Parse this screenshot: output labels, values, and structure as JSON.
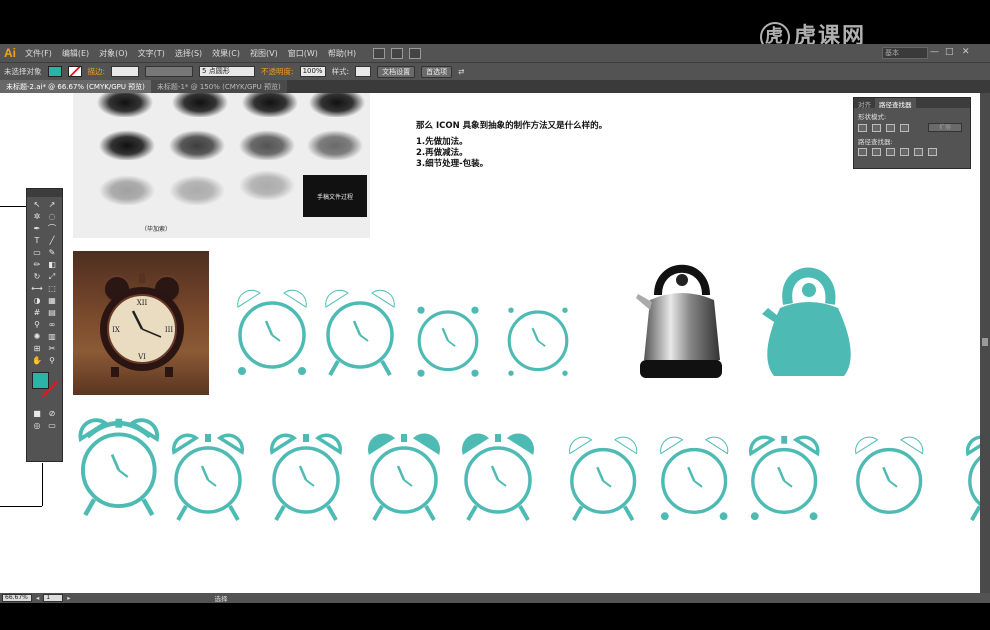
{
  "app": {
    "logo": "Ai",
    "menus": [
      "文件(F)",
      "编辑(E)",
      "对象(O)",
      "文字(T)",
      "选择(S)",
      "效果(C)",
      "视图(V)",
      "窗口(W)",
      "帮助(H)"
    ],
    "search_value": "基本",
    "window_controls": [
      "—",
      "□",
      "✕"
    ]
  },
  "watermark": {
    "circle_char": "虎",
    "text": "虎课网"
  },
  "controlbar": {
    "selection_label": "未选择对象",
    "stroke_label": "描边:",
    "brush_value": "5 点圆形",
    "opacity_label": "不透明度:",
    "opacity_value": "100%",
    "style_label": "样式:",
    "doc_settings_button": "文档设置",
    "preferences_button": "首选项",
    "fill_color": "#2db3a6"
  },
  "tabs": [
    {
      "label": "未标题-2.ai* @ 66.67% (CMYK/GPU 预览)",
      "active": true
    },
    {
      "label": "未标题-1* @ 150% (CMYK/GPU 预览)",
      "active": false
    }
  ],
  "panel": {
    "tabs": [
      "对齐",
      "路径查找器"
    ],
    "shape_modes_label": "形状模式:",
    "pathfinder_label": "路径查找器:",
    "expand_button": "扩展"
  },
  "canvas": {
    "note_title": "那么 ICON 具象到抽象的制作方法又是什么样的。",
    "note_lines": [
      "1.先做加法。",
      "2.再做减法。",
      "3.细节处理-包装。"
    ],
    "bull_caption": "（毕加索）",
    "bull_black_text": "手稿文件过程",
    "accent_color": "#4dbbb3"
  },
  "statusbar": {
    "zoom": "66.67%",
    "page": "1",
    "tool_label": "选择"
  }
}
